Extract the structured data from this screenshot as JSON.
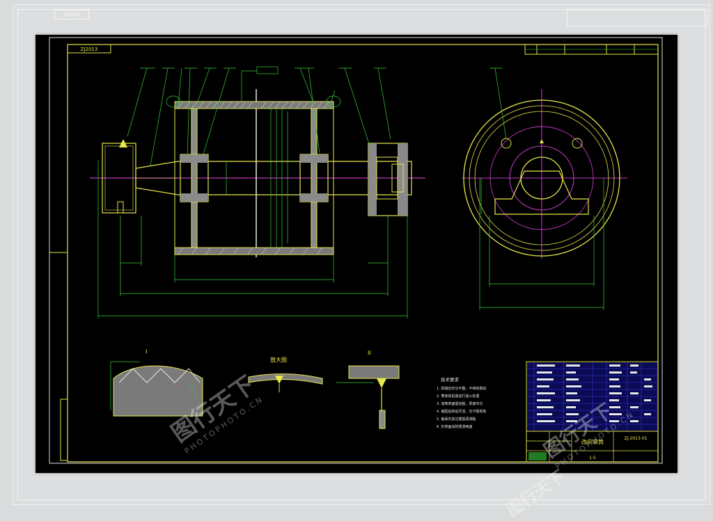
{
  "drawing_label": "ZJ2013",
  "views": {
    "section_I": "I",
    "section_II": "II",
    "detail_label": "放大图"
  },
  "tech_requirements": {
    "title": "技术要求",
    "items": [
      "1. 焊缝应均匀平整，不得有裂纹",
      "2. 筒体焊后需进行退火处理",
      "3. 滚筒表面需包胶，厚度均匀",
      "4. 装配后转动灵活，无卡阻现象",
      "5. 轴承内加注锂基润滑脂",
      "6. 外表面涂防锈漆两遍"
    ]
  },
  "title_block": {
    "name": "改向滚筒",
    "scale": "1:5",
    "drawing_no": "ZJ-2013-01"
  },
  "watermark": {
    "text": "图行天下",
    "sub": "PHOTOPHOTO.CN"
  },
  "colors": {
    "background": "#000000",
    "frame": "#e5e54a",
    "outline": "#e8e84c",
    "centerline": "#c03ac0",
    "dimension": "#39d139",
    "hatch": "#c9c9c9",
    "table": "#3a3ad6"
  }
}
